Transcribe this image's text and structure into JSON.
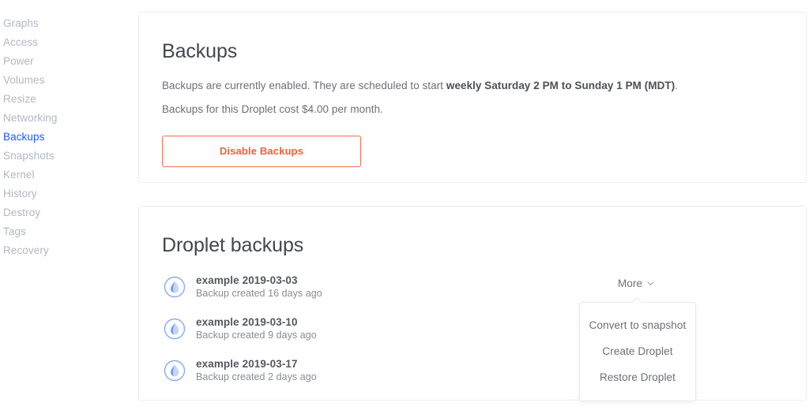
{
  "sidebar": {
    "items": [
      {
        "label": "Graphs",
        "active": false
      },
      {
        "label": "Access",
        "active": false
      },
      {
        "label": "Power",
        "active": false
      },
      {
        "label": "Volumes",
        "active": false
      },
      {
        "label": "Resize",
        "active": false
      },
      {
        "label": "Networking",
        "active": false
      },
      {
        "label": "Backups",
        "active": true
      },
      {
        "label": "Snapshots",
        "active": false
      },
      {
        "label": "Kernel",
        "active": false
      },
      {
        "label": "History",
        "active": false
      },
      {
        "label": "Destroy",
        "active": false
      },
      {
        "label": "Tags",
        "active": false
      },
      {
        "label": "Recovery",
        "active": false
      }
    ]
  },
  "backups_card": {
    "title": "Backups",
    "status_text_prefix": "Backups are currently enabled. They are scheduled to start ",
    "status_text_strong": "weekly Saturday 2 PM to Sunday 1 PM (MDT)",
    "status_text_suffix": ".",
    "cost_text": "Backups for this Droplet cost $4.00 per month.",
    "disable_button_label": "Disable Backups"
  },
  "droplet_backups_card": {
    "title": "Droplet backups",
    "items": [
      {
        "name": "example 2019-03-03",
        "subtitle": "Backup created 16 days ago",
        "icon": "droplet-icon"
      },
      {
        "name": "example 2019-03-10",
        "subtitle": "Backup created 9 days ago",
        "icon": "droplet-icon"
      },
      {
        "name": "example 2019-03-17",
        "subtitle": "Backup created 2 days ago",
        "icon": "droplet-icon"
      }
    ]
  },
  "more_menu": {
    "trigger_label": "More",
    "trigger_icon": "chevron-down-icon",
    "options": [
      "Convert to snapshot",
      "Create Droplet",
      "Restore Droplet"
    ]
  },
  "colors": {
    "accent_blue": "#1d59f3",
    "danger_orange": "#f0603d",
    "droplet_blue": "#7b9ff5",
    "card_border": "#eceef1",
    "muted_text": "#b0b7c3"
  }
}
